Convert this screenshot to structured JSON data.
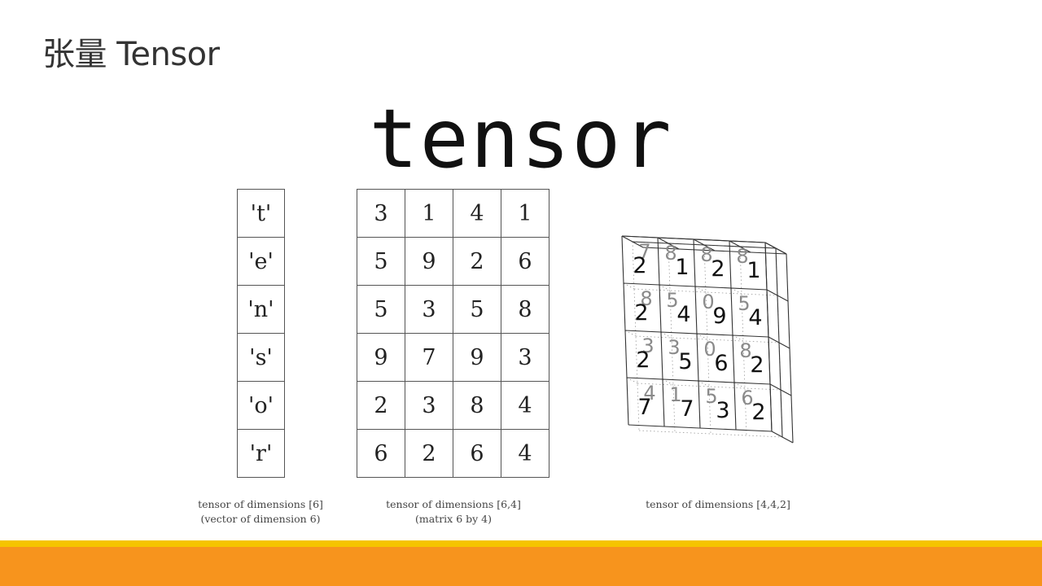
{
  "slide": {
    "title": "张量 Tensor",
    "heading": "tensor"
  },
  "vector": {
    "cells": [
      "'t'",
      "'e'",
      "'n'",
      "'s'",
      "'o'",
      "'r'"
    ],
    "caption_line1": "tensor of dimensions [6]",
    "caption_line2": "(vector of dimension 6)"
  },
  "matrix": {
    "rows": [
      [
        "3",
        "1",
        "4",
        "1"
      ],
      [
        "5",
        "9",
        "2",
        "6"
      ],
      [
        "5",
        "3",
        "5",
        "8"
      ],
      [
        "9",
        "7",
        "9",
        "3"
      ],
      [
        "2",
        "3",
        "8",
        "4"
      ],
      [
        "6",
        "2",
        "6",
        "4"
      ]
    ],
    "caption_line1": "tensor of dimensions [6,4]",
    "caption_line2": "(matrix 6 by 4)"
  },
  "cube": {
    "front_rows": [
      [
        "2",
        "1",
        "2",
        "1"
      ],
      [
        "2",
        "4",
        "9",
        "4"
      ],
      [
        "2",
        "5",
        "6",
        "2"
      ],
      [
        "7",
        "7",
        "3",
        "2"
      ]
    ],
    "back_rows": [
      [
        "7",
        "8",
        "8",
        "8"
      ],
      [
        "8",
        "5",
        "0",
        "5"
      ],
      [
        "3",
        "3",
        "0",
        "8"
      ],
      [
        "4",
        "1",
        "5",
        "6"
      ]
    ],
    "caption": "tensor of dimensions [4,4,2]"
  },
  "colors": {
    "band_yellow": "#f5c400",
    "band_orange": "#f7941d",
    "back_digit_gray": "#8a8a8a"
  }
}
